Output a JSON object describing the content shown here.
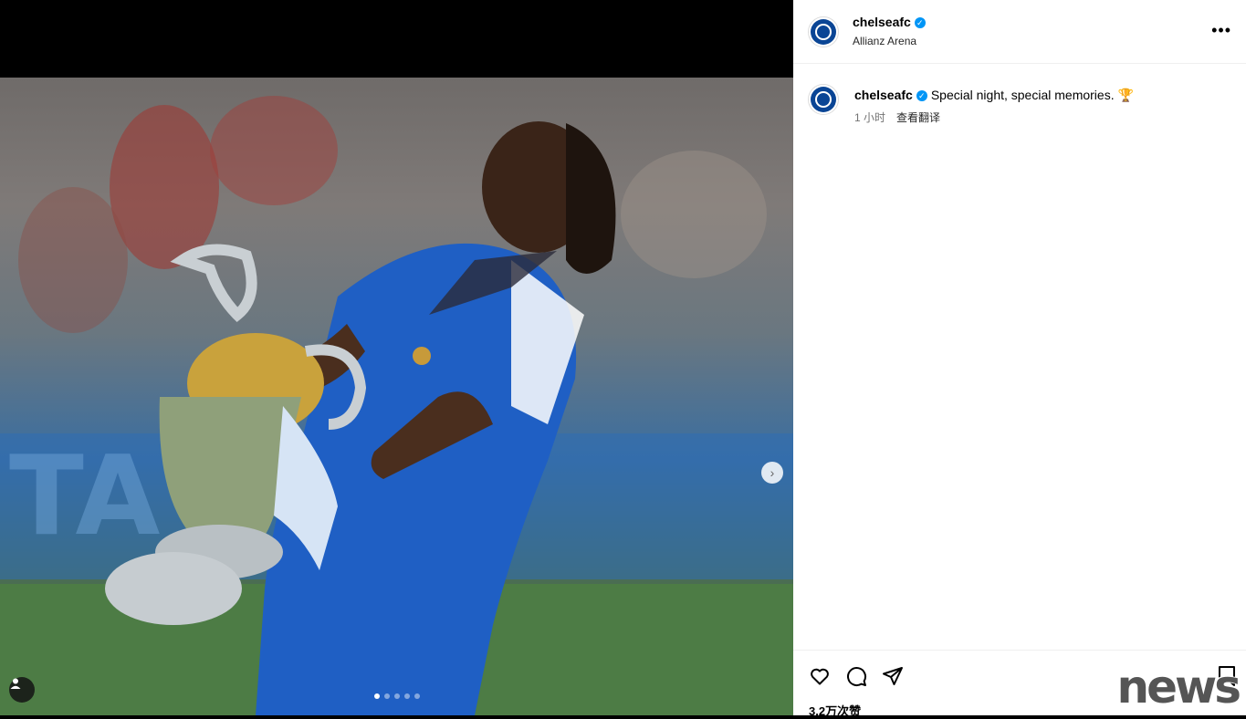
{
  "post": {
    "username": "chelseafc",
    "location": "Allianz Arena",
    "caption_text": "Special night, special memories. 🏆",
    "time_ago": "1 小时",
    "translate": "查看翻译",
    "likes": "3.2万次赞"
  },
  "watermark": "news",
  "icons": {
    "verified": "verified-badge-icon",
    "more": "more-options-icon",
    "like": "heart-icon",
    "comment": "comment-icon",
    "share": "share-icon",
    "save": "bookmark-icon",
    "next": "chevron-right-icon",
    "tag": "user-tag-icon"
  },
  "colors": {
    "brand_blue": "#0a4595",
    "verified": "#0095f6"
  },
  "carousel": {
    "total": 5,
    "current": 1
  }
}
